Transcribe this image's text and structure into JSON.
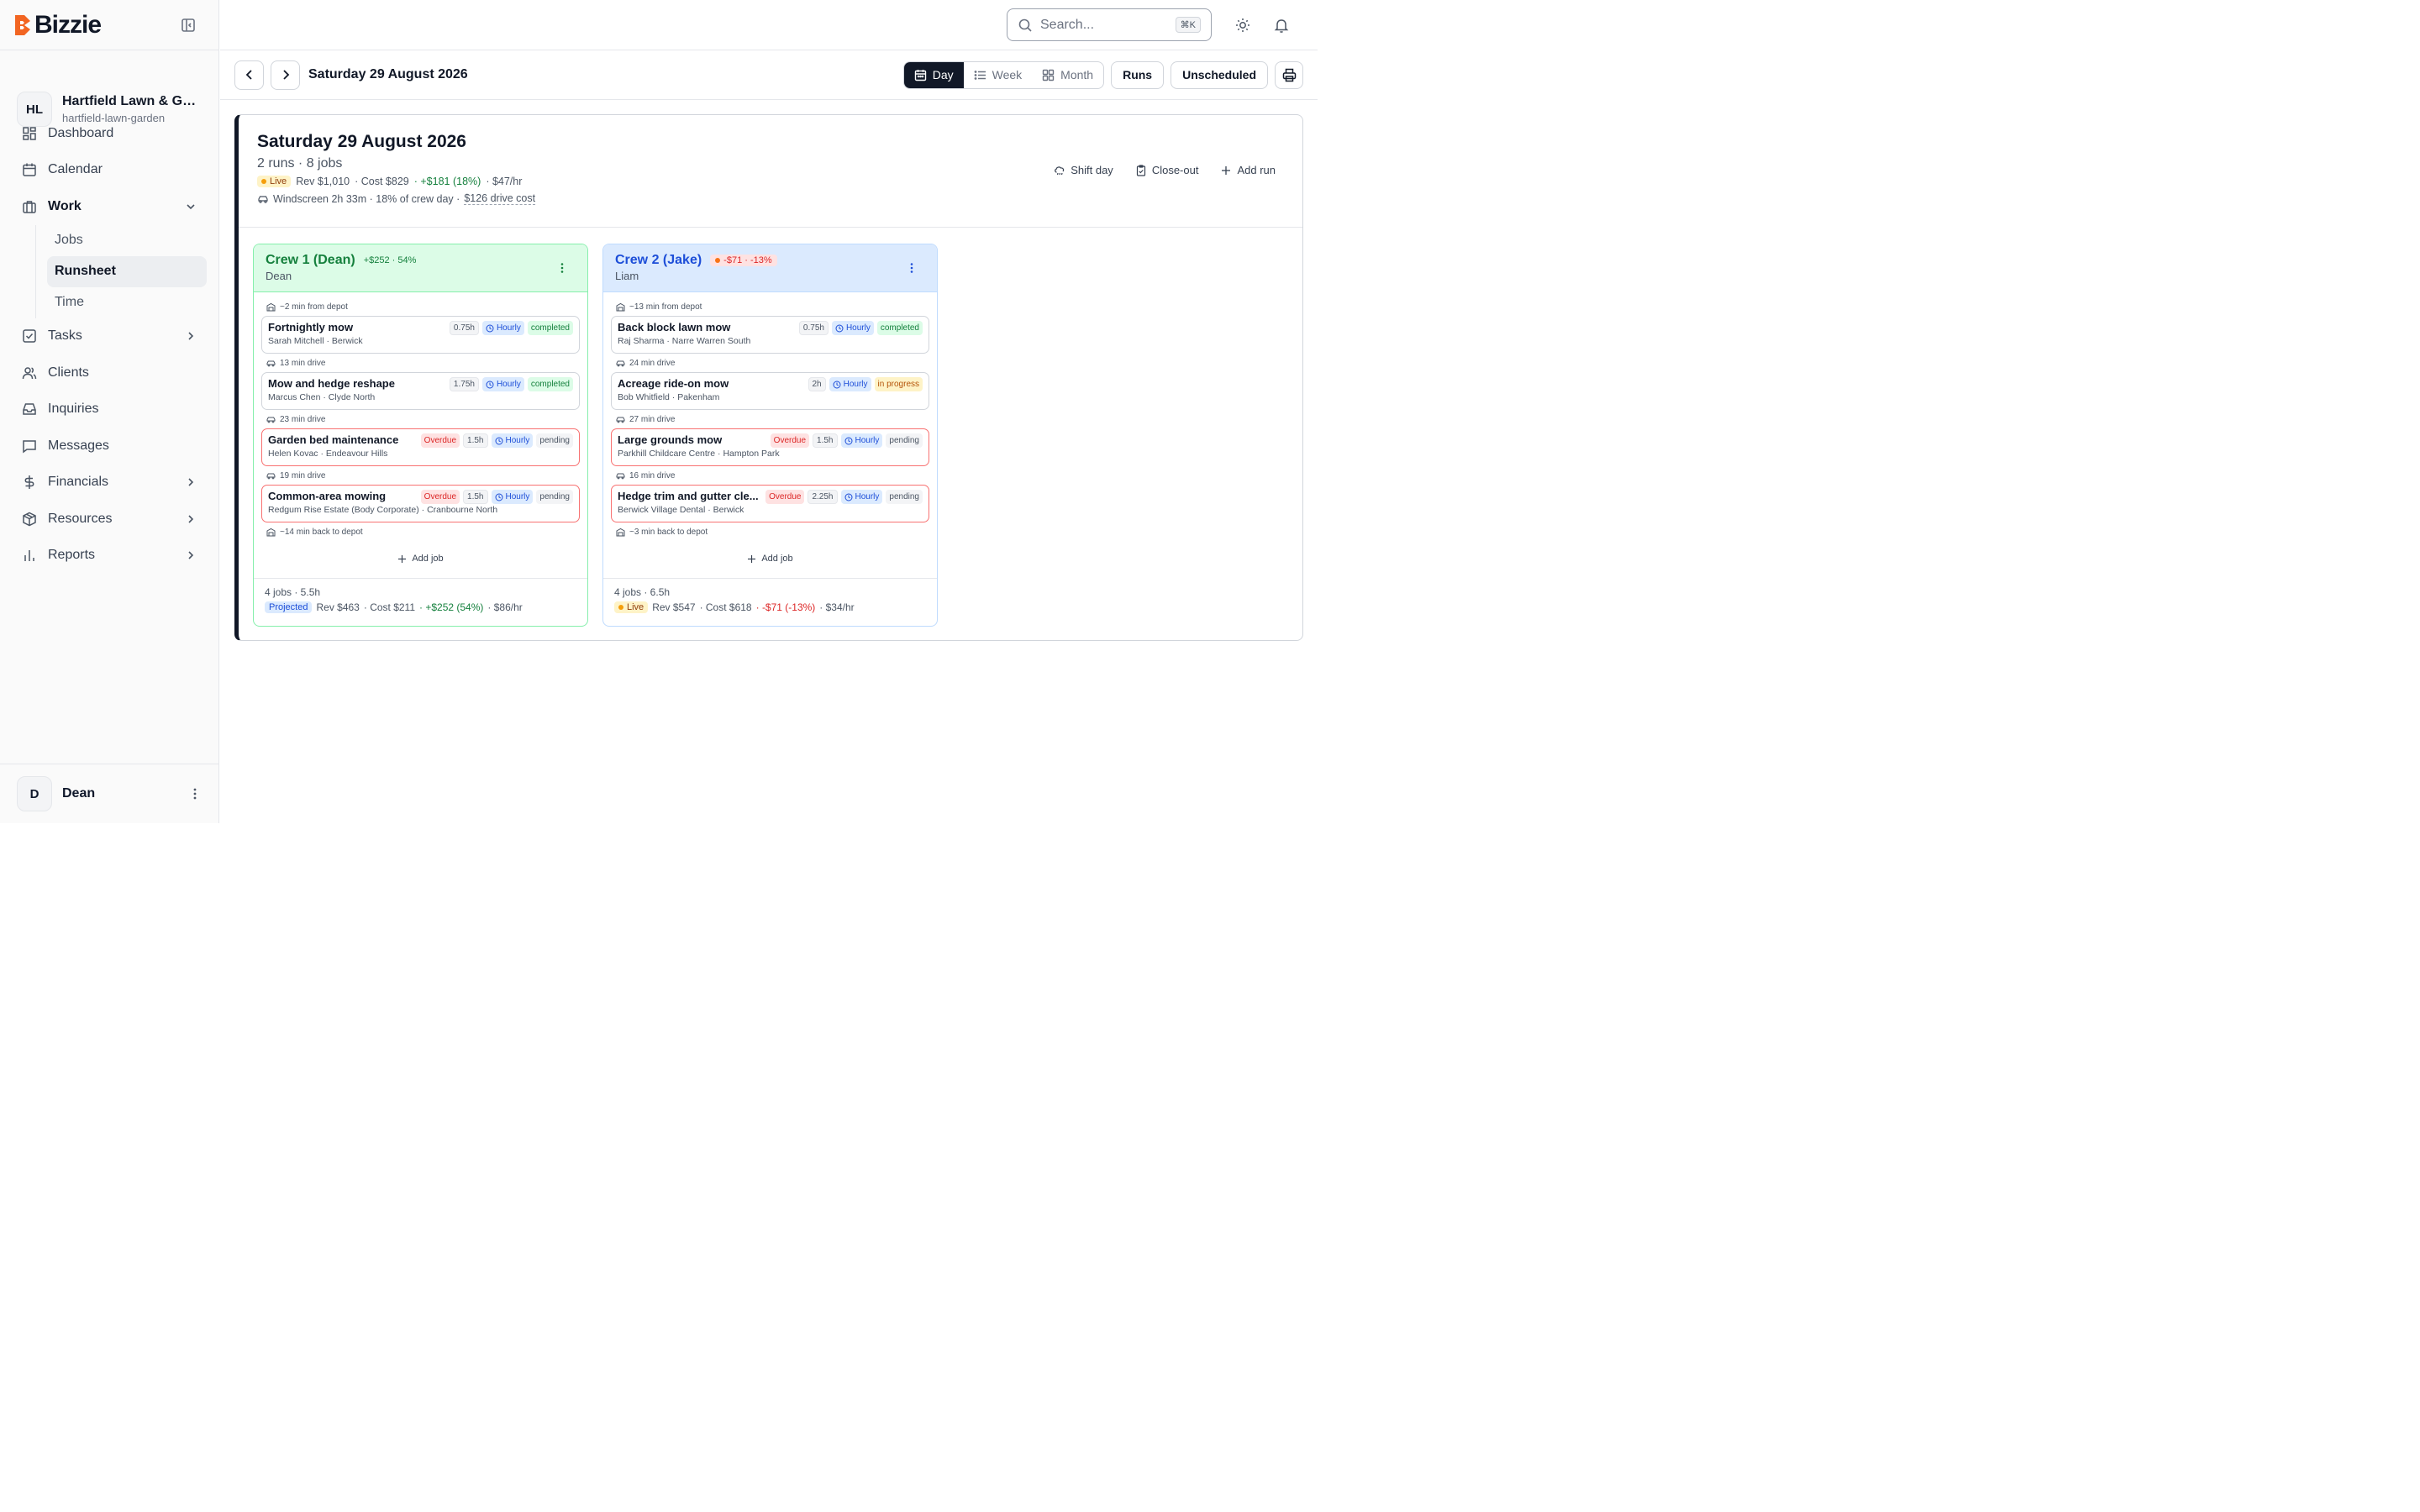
{
  "brand": {
    "name": "Bizzie"
  },
  "org": {
    "initials": "HL",
    "name": "Hartfield Lawn & Garden",
    "slug": "hartfield-lawn-garden"
  },
  "nav": {
    "dashboard": "Dashboard",
    "calendar": "Calendar",
    "work": "Work",
    "jobs": "Jobs",
    "runsheet": "Runsheet",
    "time": "Time",
    "tasks": "Tasks",
    "clients": "Clients",
    "inquiries": "Inquiries",
    "messages": "Messages",
    "financials": "Financials",
    "resources": "Resources",
    "reports": "Reports"
  },
  "user": {
    "initial": "D",
    "name": "Dean"
  },
  "search": {
    "placeholder": "Search...",
    "shortcut": "⌘K"
  },
  "toolbar": {
    "date": "Saturday 29 August 2026",
    "views": {
      "day": "Day",
      "week": "Week",
      "month": "Month"
    },
    "runs": "Runs",
    "unscheduled": "Unscheduled"
  },
  "day": {
    "title": "Saturday 29 August 2026",
    "summary": "2 runs · 8 jobs",
    "status": "Live",
    "rev": "Rev $1,010",
    "cost": "· Cost $829",
    "profit": "· +$181 (18%)",
    "rate": "· $47/hr",
    "windscreen": "Windscreen 2h 33m · 18% of crew day ·",
    "drive_cost": "$126 drive cost",
    "actions": {
      "shift": "Shift day",
      "closeout": "Close-out",
      "add_run": "Add run"
    }
  },
  "crews": [
    {
      "title": "Crew 1 (Dean)",
      "margin": "+$252 · 54%",
      "lead": "Dean",
      "depart": "~2 min from depot",
      "jobs": [
        {
          "title": "Fortnightly mow",
          "sub": "Sarah Mitchell · Berwick",
          "overdue": "",
          "duration": "0.75h",
          "rate": "Hourly",
          "status": "completed",
          "drive_after": "13 min drive"
        },
        {
          "title": "Mow and hedge reshape",
          "sub": "Marcus Chen · Clyde North",
          "overdue": "",
          "duration": "1.75h",
          "rate": "Hourly",
          "status": "completed",
          "drive_after": "23 min drive"
        },
        {
          "title": "Garden bed maintenance",
          "sub": "Helen Kovac · Endeavour Hills",
          "overdue": "Overdue",
          "duration": "1.5h",
          "rate": "Hourly",
          "status": "pending",
          "drive_after": "19 min drive"
        },
        {
          "title": "Common-area mowing",
          "sub": "Redgum Rise Estate (Body Corporate) · Cranbourne North",
          "overdue": "Overdue",
          "duration": "1.5h",
          "rate": "Hourly",
          "status": "pending",
          "drive_after": ""
        }
      ],
      "return": "~14 min back to depot",
      "add_job": "Add job",
      "foot_jobs": "4 jobs · 5.5h",
      "foot_status": "Projected",
      "foot_rev": "Rev $463",
      "foot_cost": "· Cost $211",
      "foot_profit": "· +$252 (54%)",
      "foot_rate": "· $86/hr"
    },
    {
      "title": "Crew 2 (Jake)",
      "margin": "-$71 · -13%",
      "lead": "Liam",
      "depart": "~13 min from depot",
      "jobs": [
        {
          "title": "Back block lawn mow",
          "sub": "Raj Sharma · Narre Warren South",
          "overdue": "",
          "duration": "0.75h",
          "rate": "Hourly",
          "status": "completed",
          "drive_after": "24 min drive"
        },
        {
          "title": "Acreage ride-on mow",
          "sub": "Bob Whitfield · Pakenham",
          "overdue": "",
          "duration": "2h",
          "rate": "Hourly",
          "status": "in progress",
          "drive_after": "27 min drive"
        },
        {
          "title": "Large grounds mow",
          "sub": "Parkhill Childcare Centre · Hampton Park",
          "overdue": "Overdue",
          "duration": "1.5h",
          "rate": "Hourly",
          "status": "pending",
          "drive_after": "16 min drive"
        },
        {
          "title": "Hedge trim and gutter cle...",
          "sub": "Berwick Village Dental · Berwick",
          "overdue": "Overdue",
          "duration": "2.25h",
          "rate": "Hourly",
          "status": "pending",
          "drive_after": ""
        }
      ],
      "return": "~3 min back to depot",
      "add_job": "Add job",
      "foot_jobs": "4 jobs · 6.5h",
      "foot_status": "Live",
      "foot_rev": "Rev $547",
      "foot_cost": "· Cost $618",
      "foot_profit": "· -$71 (-13%)",
      "foot_rate": "· $34/hr"
    }
  ]
}
